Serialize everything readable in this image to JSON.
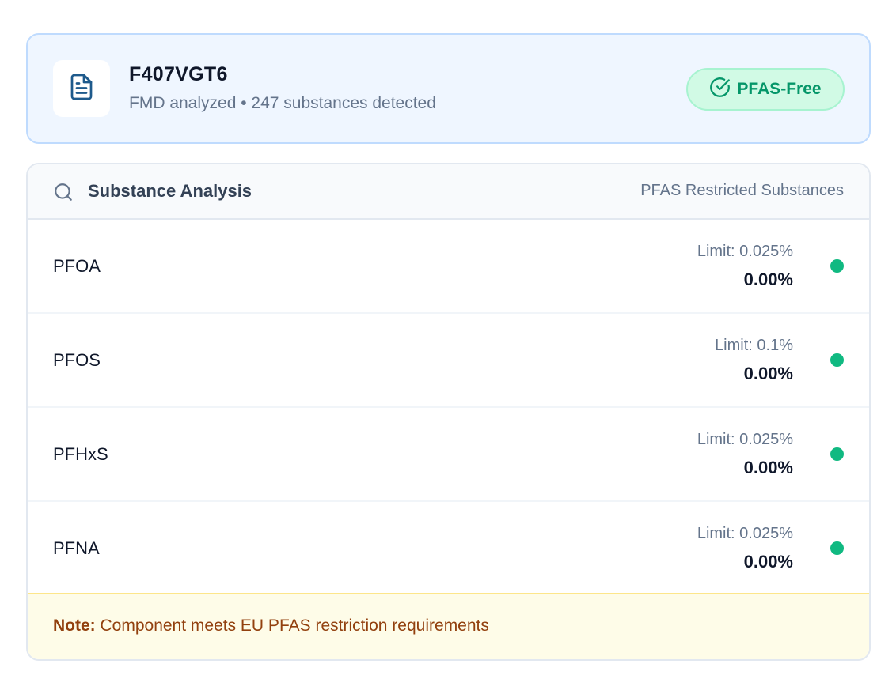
{
  "header": {
    "part_number": "F407VGT6",
    "subtitle": "FMD analyzed • 247 substances detected",
    "doc_icon": "document-icon",
    "badge": {
      "label": "PFAS-Free",
      "icon": "check-circle-icon",
      "color": "#059669"
    }
  },
  "analysis": {
    "title": "Substance Analysis",
    "title_icon": "search-icon",
    "scope": "PFAS Restricted Substances",
    "rows": [
      {
        "name": "PFOA",
        "limit": "Limit: 0.025%",
        "value": "0.00%",
        "status": "pass"
      },
      {
        "name": "PFOS",
        "limit": "Limit: 0.1%",
        "value": "0.00%",
        "status": "pass"
      },
      {
        "name": "PFHxS",
        "limit": "Limit: 0.025%",
        "value": "0.00%",
        "status": "pass"
      },
      {
        "name": "PFNA",
        "limit": "Limit: 0.025%",
        "value": "0.00%",
        "status": "pass"
      }
    ],
    "status_color": "#10b981"
  },
  "note": {
    "label": "Note:",
    "text": " Component meets EU PFAS restriction requirements"
  }
}
